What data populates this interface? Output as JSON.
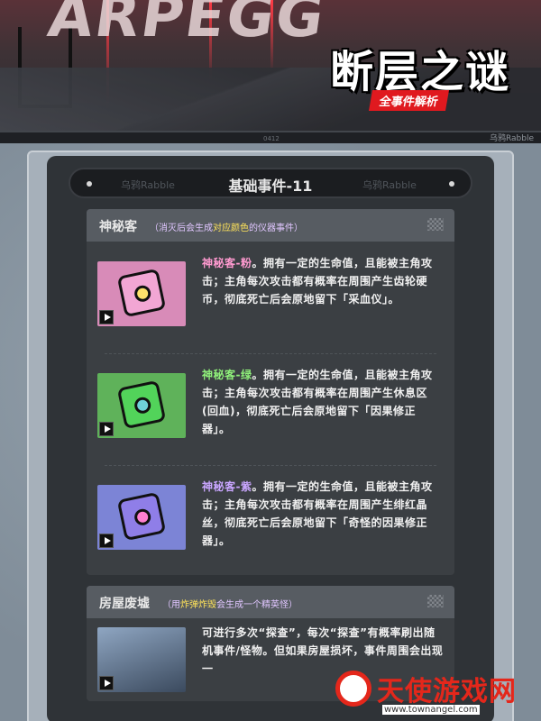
{
  "hero": {
    "logo_text": "ARPEGG",
    "title": "断层之谜",
    "subtitle": "全事件解析",
    "strip_watermark": "乌鸦Rabble",
    "strip_mid": "0412"
  },
  "section": {
    "title": "基础事件-11",
    "watermark": "乌鸦Rabble"
  },
  "card1": {
    "name": "神秘客",
    "desc_prefix": "（消灭后会生成",
    "desc_highlight": "对应颜色",
    "desc_suffix": "的仪器事件）",
    "entries": [
      {
        "name": "神秘客-粉",
        "name_color": "#ff9ad0",
        "text": "。拥有一定的生命值，且能被主角攻击；主角每次攻击都有概率在周围产生齿轮硬币，彻底死亡后会原地留下「采血仪」。",
        "thumb_bg": "#d88bb8",
        "obj_color": "#f2a6d4"
      },
      {
        "name": "神秘客-绿",
        "name_color": "#8ff07a",
        "text": "。拥有一定的生命值，且能被主角攻击；主角每次攻击都有概率在周围产生休息区(回血)，彻底死亡后会原地留下「因果修正器」。",
        "thumb_bg": "#5fb25a",
        "obj_color": "#52d35a"
      },
      {
        "name": "神秘客-紫",
        "name_color": "#c9a6ff",
        "text": "。拥有一定的生命值，且能被主角攻击；主角每次攻击都有概率在周围产生绯红晶丝，彻底死亡后会原地留下「奇怪的因果修正器」。",
        "thumb_bg": "#7c84d6",
        "obj_color": "#8f7ee8"
      }
    ]
  },
  "card2": {
    "name": "房屋废墟",
    "desc_prefix": "（用",
    "desc_highlight": "炸弹炸毁",
    "desc_suffix": "会生成一个精英怪）",
    "entry_text": "可进行多次“探查”，每次“探查”有概率刷出随机事件/怪物。但如果房屋损坏，事件周围会出现一"
  },
  "site_logo": {
    "name": "天使游戏网",
    "url": "www.townangel.com"
  },
  "colors": {
    "accent": "#e0191f",
    "card_bg": "#3b3f43",
    "header_bg": "#575c62"
  }
}
